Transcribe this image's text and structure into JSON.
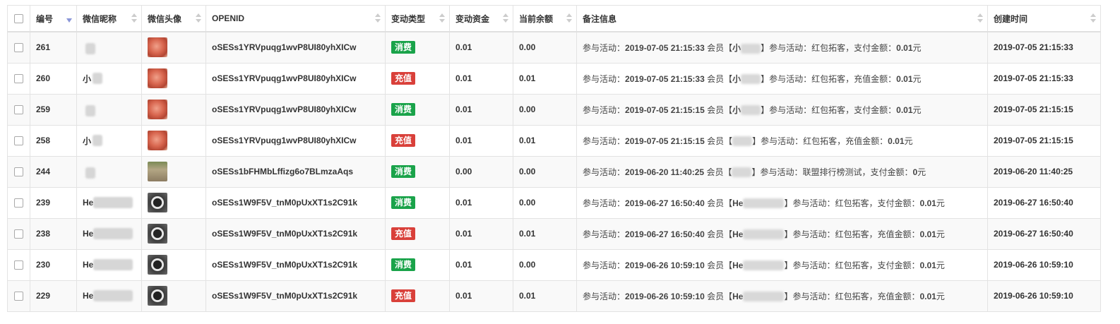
{
  "columns": [
    {
      "key": "select",
      "label": ""
    },
    {
      "key": "id",
      "label": "编号"
    },
    {
      "key": "nickname",
      "label": "微信昵称"
    },
    {
      "key": "avatar",
      "label": "微信头像"
    },
    {
      "key": "openid",
      "label": "OPENID"
    },
    {
      "key": "type",
      "label": "变动类型"
    },
    {
      "key": "amount",
      "label": "变动资金"
    },
    {
      "key": "balance",
      "label": "当前余额"
    },
    {
      "key": "remark",
      "label": "备注信息"
    },
    {
      "key": "created",
      "label": "创建时间"
    }
  ],
  "colors": {
    "consume": "#1aa34a",
    "recharge": "#d9403a",
    "sort_active": "#8a96d8"
  },
  "rows": [
    {
      "id": "261",
      "nick_prefix": "",
      "avatar": "rose-icon",
      "openid": "oSESs1YRVpuqg1wvP8UI80yhXICw",
      "type": "消费",
      "type_kind": "consume",
      "amount": "0.01",
      "balance": "0.00",
      "remark_head": "参与活动：",
      "remark_time": "2019-07-05 21:15:33",
      "remark_mid": " 会员【",
      "remark_mem": "小",
      "remark_close": "】参与活动：红包拓客，支付金额：",
      "remark_amt": "0.01",
      "remark_unit": "元",
      "created": "2019-07-05 21:15:33"
    },
    {
      "id": "260",
      "nick_prefix": "小",
      "avatar": "rose-icon",
      "openid": "oSESs1YRVpuqg1wvP8UI80yhXICw",
      "type": "充值",
      "type_kind": "recharge",
      "amount": "0.01",
      "balance": "0.01",
      "remark_head": "参与活动：",
      "remark_time": "2019-07-05 21:15:33",
      "remark_mid": " 会员【",
      "remark_mem": "小",
      "remark_close": "】参与活动：红包拓客，充值金额：",
      "remark_amt": "0.01",
      "remark_unit": "元",
      "created": "2019-07-05 21:15:33"
    },
    {
      "id": "259",
      "nick_prefix": "",
      "avatar": "rose-icon",
      "openid": "oSESs1YRVpuqg1wvP8UI80yhXICw",
      "type": "消费",
      "type_kind": "consume",
      "amount": "0.01",
      "balance": "0.00",
      "remark_head": "参与活动：",
      "remark_time": "2019-07-05 21:15:15",
      "remark_mid": " 会员【",
      "remark_mem": "小",
      "remark_close": "】参与活动：红包拓客，支付金额：",
      "remark_amt": "0.01",
      "remark_unit": "元",
      "created": "2019-07-05 21:15:15"
    },
    {
      "id": "258",
      "nick_prefix": "小",
      "avatar": "rose-icon",
      "openid": "oSESs1YRVpuqg1wvP8UI80yhXICw",
      "type": "充值",
      "type_kind": "recharge",
      "amount": "0.01",
      "balance": "0.01",
      "remark_head": "参与活动：",
      "remark_time": "2019-07-05 21:15:15",
      "remark_mid": " 会员【",
      "remark_mem": "",
      "remark_close": "】参与活动：红包拓客，充值金额：",
      "remark_amt": "0.01",
      "remark_unit": "元",
      "created": "2019-07-05 21:15:15"
    },
    {
      "id": "244",
      "nick_prefix": "",
      "avatar": "face-icon",
      "openid": "oSESs1bFHMbLffizg6o7BLmzaAqs",
      "type": "消费",
      "type_kind": "consume",
      "amount": "0.00",
      "balance": "0.00",
      "remark_head": "参与活动：",
      "remark_time": "2019-06-20 11:40:25",
      "remark_mid": " 会员【",
      "remark_mem": "",
      "remark_close": "】参与活动：联盟排行榜测试，支付金额：",
      "remark_amt": "0",
      "remark_unit": "元",
      "created": "2019-06-20 11:40:25"
    },
    {
      "id": "239",
      "nick_prefix": "He",
      "avatar": "cup-icon",
      "openid": "oSESs1W9F5V_tnM0pUxXT1s2C91k",
      "type": "消费",
      "type_kind": "consume",
      "amount": "0.01",
      "balance": "0.00",
      "remark_head": "参与活动：",
      "remark_time": "2019-06-27 16:50:40",
      "remark_mid": " 会员【",
      "remark_mem": "He",
      "remark_close": "】参与活动：红包拓客，支付金额：",
      "remark_amt": "0.01",
      "remark_unit": "元",
      "created": "2019-06-27 16:50:40"
    },
    {
      "id": "238",
      "nick_prefix": "He",
      "avatar": "cup-icon",
      "openid": "oSESs1W9F5V_tnM0pUxXT1s2C91k",
      "type": "充值",
      "type_kind": "recharge",
      "amount": "0.01",
      "balance": "0.01",
      "remark_head": "参与活动：",
      "remark_time": "2019-06-27 16:50:40",
      "remark_mid": " 会员【",
      "remark_mem": "He",
      "remark_close": "】参与活动：红包拓客，充值金额：",
      "remark_amt": "0.01",
      "remark_unit": "元",
      "created": "2019-06-27 16:50:40"
    },
    {
      "id": "230",
      "nick_prefix": "He",
      "avatar": "cup-icon",
      "openid": "oSESs1W9F5V_tnM0pUxXT1s2C91k",
      "type": "消费",
      "type_kind": "consume",
      "amount": "0.01",
      "balance": "0.00",
      "remark_head": "参与活动：",
      "remark_time": "2019-06-26 10:59:10",
      "remark_mid": " 会员【",
      "remark_mem": "He",
      "remark_close": "】参与活动：红包拓客，支付金额：",
      "remark_amt": "0.01",
      "remark_unit": "元",
      "created": "2019-06-26 10:59:10"
    },
    {
      "id": "229",
      "nick_prefix": "He",
      "avatar": "cup-icon",
      "openid": "oSESs1W9F5V_tnM0pUxXT1s2C91k",
      "type": "充值",
      "type_kind": "recharge",
      "amount": "0.01",
      "balance": "0.01",
      "remark_head": "参与活动：",
      "remark_time": "2019-06-26 10:59:10",
      "remark_mid": " 会员【",
      "remark_mem": "He",
      "remark_close": "】参与活动：红包拓客，充值金额：",
      "remark_amt": "0.01",
      "remark_unit": "元",
      "created": "2019-06-26 10:59:10"
    }
  ]
}
